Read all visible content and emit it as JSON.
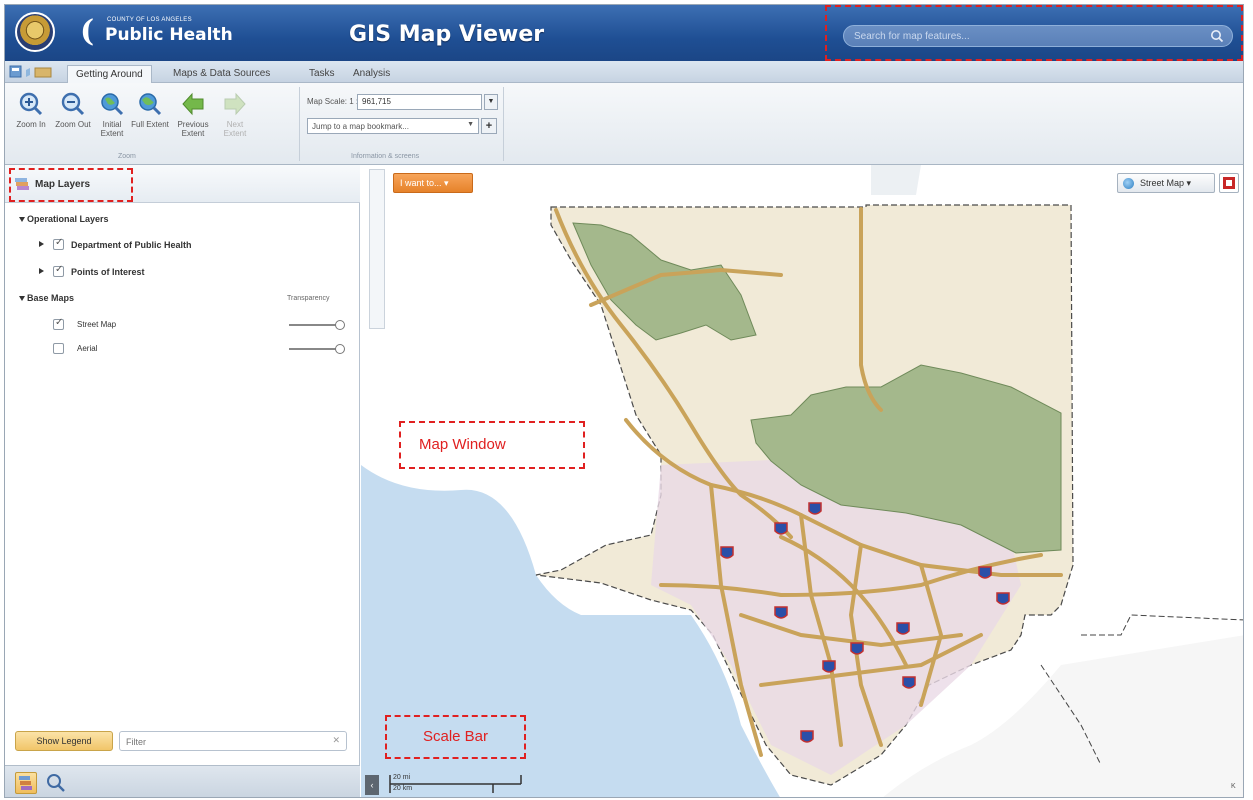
{
  "header": {
    "brand_small": "COUNTY OF LOS ANGELES",
    "brand_name": "Public Health",
    "app_title": "GIS Map Viewer",
    "search_placeholder": "Search for map features..."
  },
  "ribbon": {
    "tabs": [
      {
        "label": "Getting Around",
        "active": true
      },
      {
        "label": "Maps & Data Sources",
        "active": false
      },
      {
        "label": "Tasks",
        "active": false
      },
      {
        "label": "Analysis",
        "active": false
      }
    ],
    "buttons": [
      {
        "label": "Zoom In",
        "icon": "zoom-in-icon",
        "enabled": true
      },
      {
        "label": "Zoom Out",
        "icon": "zoom-out-icon",
        "enabled": true
      },
      {
        "label": "Initial Extent",
        "icon": "globe-icon",
        "enabled": true
      },
      {
        "label": "Full Extent",
        "icon": "globe-icon",
        "enabled": true
      },
      {
        "label": "Previous Extent",
        "icon": "arrow-left-icon",
        "enabled": true
      },
      {
        "label": "Next Extent",
        "icon": "arrow-right-icon",
        "enabled": false
      }
    ],
    "group_zoom_label": "Zoom",
    "group_info_label": "Information & screens",
    "map_scale_label": "Map Scale: 1 :",
    "map_scale_value": "961,715",
    "bookmark_placeholder": "Jump to a map bookmark..."
  },
  "panel": {
    "title": "Map Layers",
    "operational_heading": "Operational Layers",
    "operational_layers": [
      {
        "label": "Department of Public Health",
        "checked": true
      },
      {
        "label": "Points of Interest",
        "checked": true
      }
    ],
    "basemaps_heading": "Base Maps",
    "transparency_label": "Transparency",
    "basemaps": [
      {
        "label": "Street Map",
        "checked": true
      },
      {
        "label": "Aerial",
        "checked": false
      }
    ],
    "show_legend_label": "Show Legend",
    "filter_placeholder": "Filter"
  },
  "map": {
    "i_want_to_label": "I want to...",
    "basemap_label": "Street Map",
    "map_window_annotation": "Map Window",
    "scale_bar_annotation": "Scale Bar",
    "scale_mi": "20 mi",
    "scale_km": "20 km",
    "attribution_glyph": "K"
  },
  "colors": {
    "header_blue": "#1f4f94",
    "forest_green": "#8fa878",
    "highway": "#c9a35a",
    "ocean": "#c5dcf0",
    "annotation_red": "#e02020",
    "accent_orange": "#e6822a"
  }
}
